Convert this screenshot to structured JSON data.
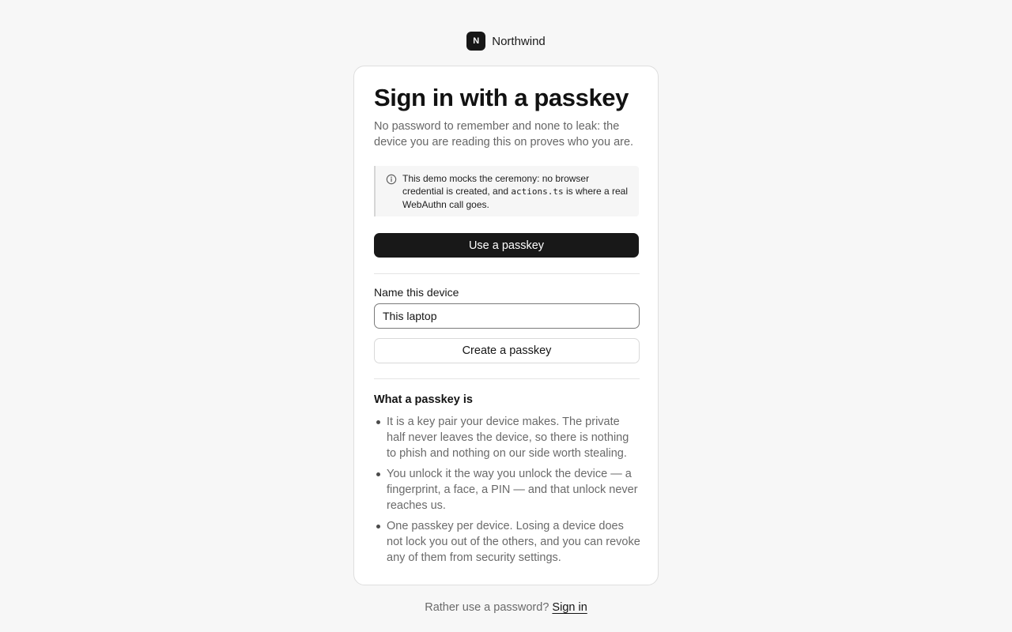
{
  "brand": {
    "mark": "N",
    "name": "Northwind"
  },
  "card": {
    "title": "Sign in with a passkey",
    "subtitle": "No password to remember and none to leak: the device you are reading this on proves who you are.",
    "notice": {
      "icon": "info-icon",
      "text_before": "This demo mocks the ceremony: no browser credential is created, and ",
      "code": "actions.ts",
      "text_after": " is where a real WebAuthn call goes."
    },
    "primary_button_label": "Use a passkey",
    "device_field": {
      "label": "Name this device",
      "value": "This laptop"
    },
    "secondary_button_label": "Create a passkey",
    "facts_heading": "What a passkey is",
    "facts": [
      "It is a key pair your device makes. The private half never leaves the device, so there is nothing to phish and nothing on our side worth stealing.",
      "You unlock it the way you unlock the device — a fingerprint, a face, a PIN — and that unlock never reaches us.",
      "One passkey per device. Losing a device does not lock you out of the others, and you can revoke any of them from security settings."
    ]
  },
  "footer": {
    "prompt": "Rather use a password? ",
    "link_label": "Sign in"
  },
  "colors": {
    "background": "#f7f7f7",
    "primary_button": "#181818",
    "muted_text": "#666666"
  }
}
